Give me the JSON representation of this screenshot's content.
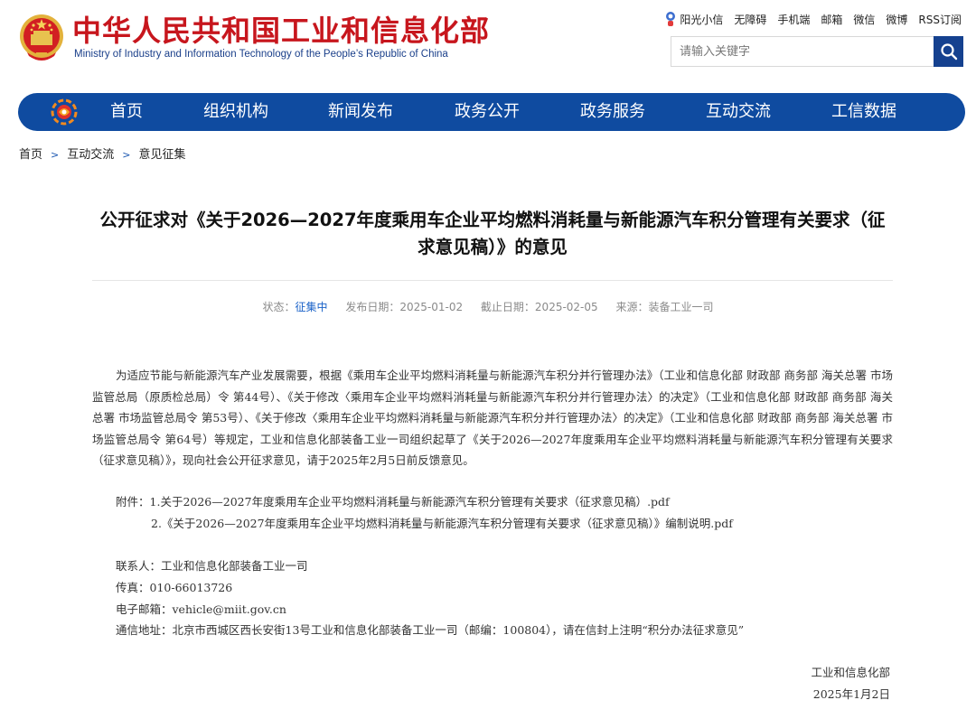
{
  "header": {
    "title_cn": "中华人民共和国工业和信息化部",
    "title_en": "Ministry of Industry and Information Technology of the People’s Republic of China",
    "links": [
      "阳光小信",
      "无障碍",
      "手机端",
      "邮箱",
      "微信",
      "微博",
      "RSS订阅"
    ],
    "search_placeholder": "请输入关键字",
    "emblem_icon": "national-emblem-icon",
    "search_icon": "search-icon"
  },
  "nav": {
    "items": [
      "首页",
      "组织机构",
      "新闻发布",
      "政务公开",
      "政务服务",
      "互动交流",
      "工信数据"
    ],
    "logo_icon": "miit-logo-icon"
  },
  "breadcrumb": [
    "首页",
    "互动交流",
    "意见征集"
  ],
  "article": {
    "title": "公开征求对《关于2026—2027年度乘用车企业平均燃料消耗量与新能源汽车积分管理有关要求（征求意见稿）》的意见",
    "meta": {
      "status_label": "状态：",
      "status_value": "征集中",
      "publish": "发布日期：2025-01-02",
      "deadline": "截止日期：2025-02-05",
      "source": "来源：装备工业一司"
    },
    "paragraph": "为适应节能与新能源汽车产业发展需要，根据《乘用车企业平均燃料消耗量与新能源汽车积分并行管理办法》（工业和信息化部 财政部 商务部 海关总署 市场监管总局（原质检总局）令 第44号）、《关于修改〈乘用车企业平均燃料消耗量与新能源汽车积分并行管理办法〉的决定》（工业和信息化部 财政部 商务部 海关总署 市场监管总局令 第53号）、《关于修改〈乘用车企业平均燃料消耗量与新能源汽车积分并行管理办法〉的决定》（工业和信息化部 财政部 商务部 海关总署 市场监管总局令 第64号）等规定，工业和信息化部装备工业一司组织起草了《关于2026—2027年度乘用车企业平均燃料消耗量与新能源汽车积分管理有关要求（征求意见稿）》，现向社会公开征求意见，请于2025年2月5日前反馈意见。",
    "attachments_label": "附件：",
    "attachments": [
      "1.关于2026—2027年度乘用车企业平均燃料消耗量与新能源汽车积分管理有关要求（征求意见稿）.pdf",
      "2.《关于2026—2027年度乘用车企业平均燃料消耗量与新能源汽车积分管理有关要求（征求意见稿）》编制说明.pdf"
    ],
    "contact": "联系人：工业和信息化部装备工业一司",
    "fax": "传真：010-66013726",
    "email": "电子邮箱：vehicle@miit.gov.cn",
    "address": "通信地址：北京市西城区西长安街13号工业和信息化部装备工业一司（邮编：100804），请在信封上注明“积分办法征求意见”",
    "signature_org": "工业和信息化部",
    "signature_date": "2025年1月2日"
  },
  "colors": {
    "brand_red": "#c7161d",
    "nav_blue": "#0f4ba0",
    "status_blue": "#1a62c8"
  }
}
